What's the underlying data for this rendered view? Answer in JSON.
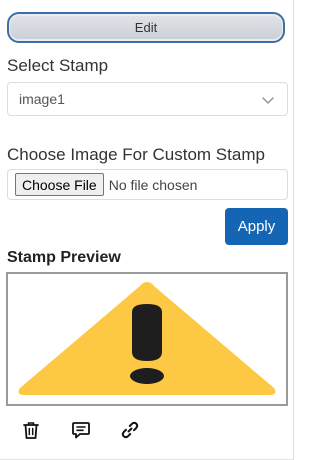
{
  "edit_button": {
    "label": "Edit"
  },
  "stamp_select": {
    "label": "Select Stamp",
    "selected_value": "image1",
    "icon": "chevron-down-icon"
  },
  "custom_stamp": {
    "label": "Choose Image For Custom Stamp",
    "choose_button_label": "Choose File",
    "file_status": "No file chosen"
  },
  "apply_button": {
    "label": "Apply"
  },
  "preview": {
    "title": "Stamp Preview",
    "image": "warning-exclamation-triangle",
    "colors": {
      "triangle": "#fdc945",
      "mark": "#1e1e1e"
    }
  },
  "actions": [
    {
      "name": "delete",
      "icon": "trash-icon"
    },
    {
      "name": "comment",
      "icon": "comment-icon"
    },
    {
      "name": "link",
      "icon": "link-icon"
    }
  ],
  "colors": {
    "accent": "#1565b5",
    "edit_border": "#3d6ea5",
    "preview_border": "#9a9a9a"
  }
}
